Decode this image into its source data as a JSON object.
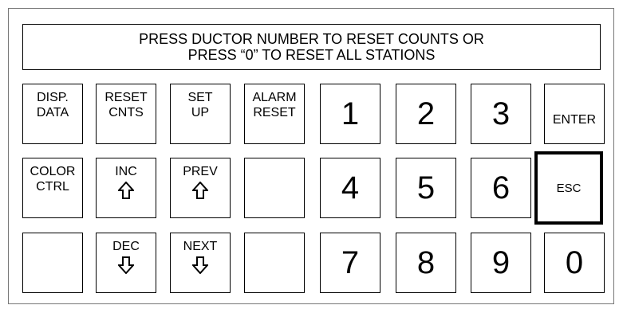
{
  "message": {
    "line1": "PRESS DUCTOR NUMBER TO RESET COUNTS OR",
    "line2": "PRESS “0” TO RESET ALL STATIONS"
  },
  "keys": {
    "disp_data": {
      "line1": "DISP.",
      "line2": "DATA"
    },
    "reset_cnts": {
      "line1": "RESET",
      "line2": "CNTS"
    },
    "set_up": {
      "line1": "SET",
      "line2": "UP"
    },
    "alarm_reset": {
      "line1": "ALARM",
      "line2": "RESET"
    },
    "color_ctrl": {
      "line1": "COLOR",
      "line2": "CTRL"
    },
    "inc": {
      "label": "INC",
      "arrow": "up-arrow-icon"
    },
    "prev": {
      "label": "PREV",
      "arrow": "up-arrow-icon"
    },
    "dec": {
      "label": "DEC",
      "arrow": "down-arrow-icon"
    },
    "next": {
      "label": "NEXT",
      "arrow": "down-arrow-icon"
    },
    "enter": "ENTER",
    "esc": "ESC",
    "digits": {
      "d1": "1",
      "d2": "2",
      "d3": "3",
      "d4": "4",
      "d5": "5",
      "d6": "6",
      "d7": "7",
      "d8": "8",
      "d9": "9",
      "d0": "0"
    }
  }
}
